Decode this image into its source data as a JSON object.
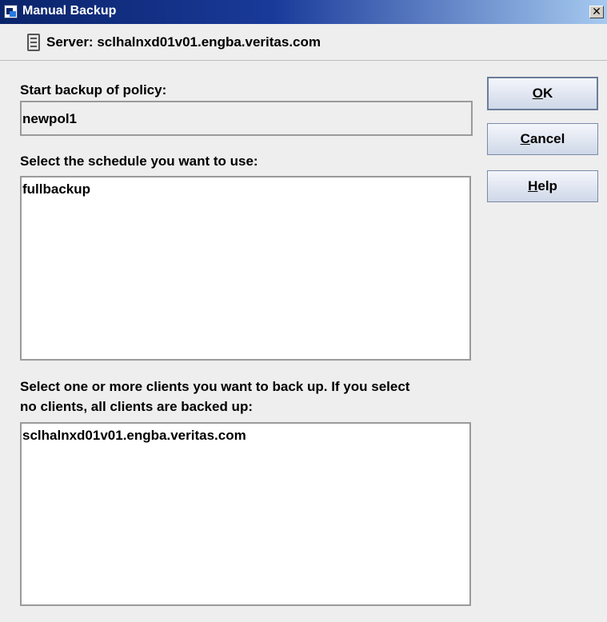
{
  "window": {
    "title": "Manual Backup",
    "close_glyph": "✕"
  },
  "server": {
    "label": "Server: sclhalnxd01v01.engba.veritas.com"
  },
  "policy": {
    "label": "Start backup of policy:",
    "value": "newpol1"
  },
  "schedule": {
    "label": "Select the schedule you want to use:",
    "items": [
      "fullbackup"
    ]
  },
  "clients": {
    "label_line1": "Select one or more clients you want to back up. If you select",
    "label_line2": "no clients, all clients are backed up:",
    "items": [
      "sclhalnxd01v01.engba.veritas.com"
    ]
  },
  "buttons": {
    "ok": {
      "mnemonic": "O",
      "rest": "K"
    },
    "cancel": {
      "mnemonic": "C",
      "rest": "ancel"
    },
    "help": {
      "mnemonic": "H",
      "rest": "elp"
    }
  },
  "icons": {
    "app": "window-app-icon",
    "server": "server-icon",
    "close": "close-icon"
  }
}
